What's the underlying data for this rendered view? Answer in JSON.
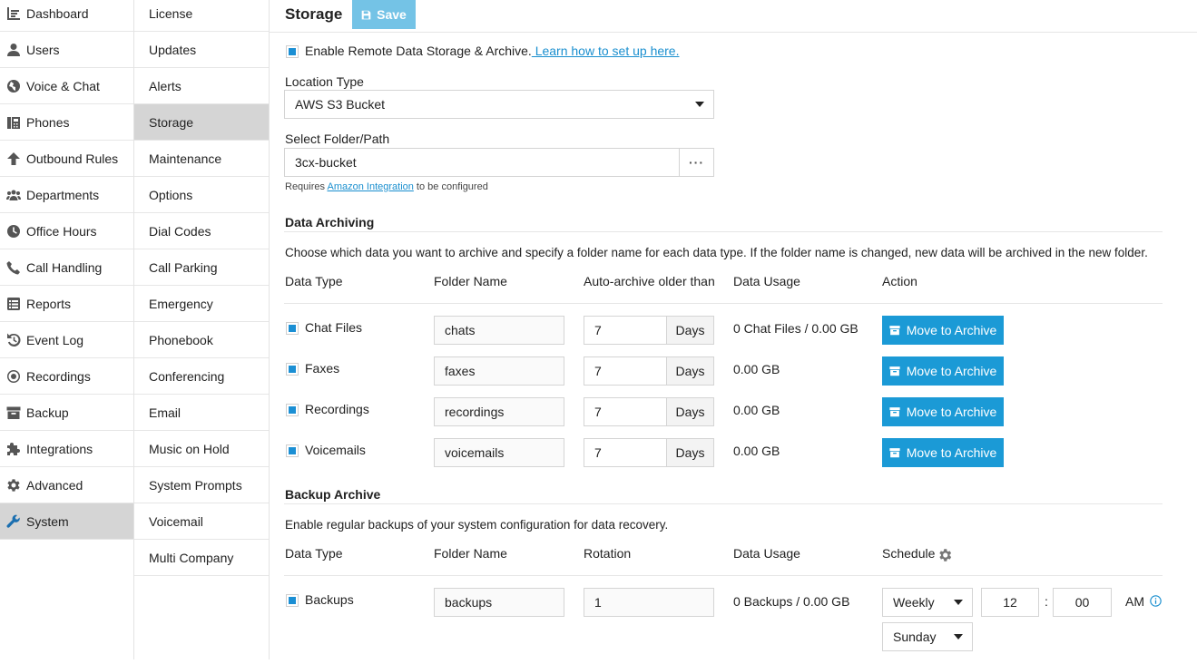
{
  "nav_primary": [
    {
      "label": "Dashboard",
      "icon": "dashboard-icon"
    },
    {
      "label": "Users",
      "icon": "user-icon"
    },
    {
      "label": "Voice & Chat",
      "icon": "globe-icon"
    },
    {
      "label": "Phones",
      "icon": "phones-icon"
    },
    {
      "label": "Outbound Rules",
      "icon": "arrow-up-icon"
    },
    {
      "label": "Departments",
      "icon": "group-icon"
    },
    {
      "label": "Office Hours",
      "icon": "clock-icon"
    },
    {
      "label": "Call Handling",
      "icon": "phone-icon"
    },
    {
      "label": "Reports",
      "icon": "reports-icon"
    },
    {
      "label": "Event Log",
      "icon": "history-icon"
    },
    {
      "label": "Recordings",
      "icon": "record-icon"
    },
    {
      "label": "Backup",
      "icon": "archive-icon"
    },
    {
      "label": "Integrations",
      "icon": "puzzle-icon"
    },
    {
      "label": "Advanced",
      "icon": "gear-icon"
    },
    {
      "label": "System",
      "icon": "wrench-icon",
      "active": true
    }
  ],
  "nav_secondary": [
    {
      "label": "License"
    },
    {
      "label": "Updates"
    },
    {
      "label": "Alerts"
    },
    {
      "label": "Storage",
      "active": true
    },
    {
      "label": "Maintenance"
    },
    {
      "label": "Options"
    },
    {
      "label": "Dial Codes"
    },
    {
      "label": "Call Parking"
    },
    {
      "label": "Emergency"
    },
    {
      "label": "Phonebook"
    },
    {
      "label": "Conferencing"
    },
    {
      "label": "Email"
    },
    {
      "label": "Music on Hold"
    },
    {
      "label": "System Prompts"
    },
    {
      "label": "Voicemail"
    },
    {
      "label": "Multi Company"
    }
  ],
  "header": {
    "title": "Storage",
    "save_label": "Save"
  },
  "remote": {
    "enable_label": "Enable Remote Data Storage & Archive.",
    "learn_link": " Learn how to set up here.",
    "location_type_label": "Location Type",
    "location_type_value": "AWS S3 Bucket",
    "folder_label": "Select Folder/Path",
    "folder_value": "3cx-bucket",
    "browse_label": "···",
    "requires_prefix": "Requires ",
    "requires_link": "Amazon Integration",
    "requires_suffix": " to be configured"
  },
  "archiving": {
    "title": "Data Archiving",
    "description": "Choose which data you want to archive and specify a folder name for each data type. If the folder name is changed, new data will be archived in the new folder.",
    "headers": [
      "Data Type",
      "Folder Name",
      "Auto-archive older than",
      "Data Usage",
      "Action"
    ],
    "unit": "Days",
    "action_label": "Move to Archive",
    "rows": [
      {
        "type": "Chat Files",
        "folder": "chats",
        "days": "7",
        "usage": "0 Chat Files / 0.00 GB"
      },
      {
        "type": "Faxes",
        "folder": "faxes",
        "days": "7",
        "usage": "0.00 GB"
      },
      {
        "type": "Recordings",
        "folder": "recordings",
        "days": "7",
        "usage": "0.00 GB"
      },
      {
        "type": "Voicemails",
        "folder": "voicemails",
        "days": "7",
        "usage": "0.00 GB"
      }
    ]
  },
  "backup": {
    "title": "Backup Archive",
    "description": "Enable regular backups of your system configuration for data recovery.",
    "headers": [
      "Data Type",
      "Folder Name",
      "Rotation",
      "Data Usage",
      "Schedule"
    ],
    "row": {
      "type": "Backups",
      "folder": "backups",
      "rotation": "1",
      "usage": "0 Backups / 0.00 GB",
      "frequency": "Weekly",
      "hour": "12",
      "colon": ":",
      "minute": "00",
      "ampm": "AM",
      "day": "Sunday"
    }
  },
  "colors": {
    "accent": "#1b9ad6",
    "save": "#74c3e6",
    "active_nav": "#d5d5d5"
  }
}
